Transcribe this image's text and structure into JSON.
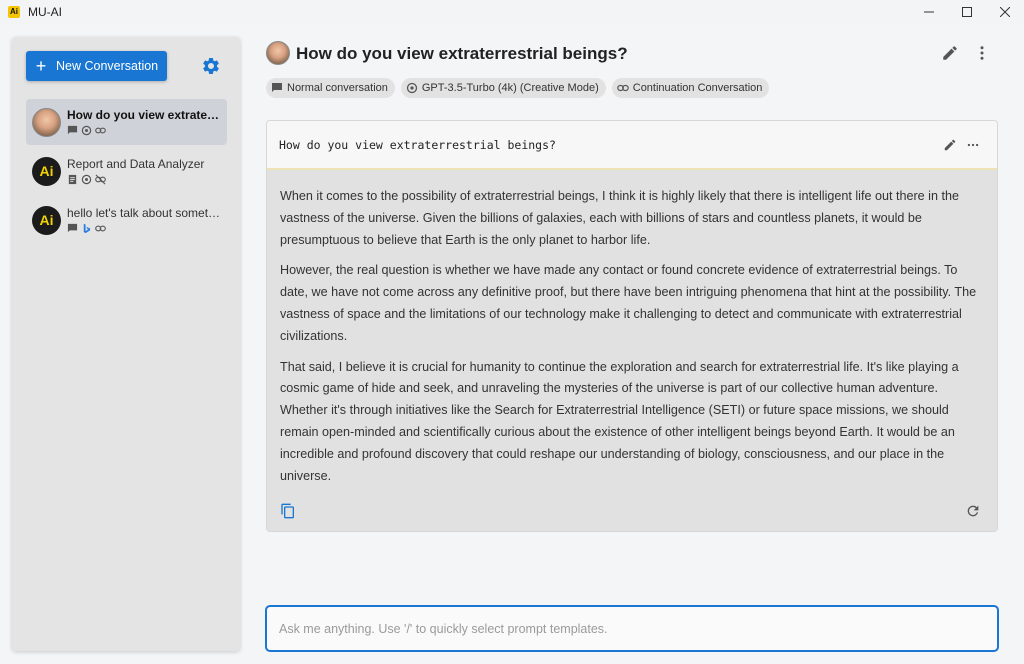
{
  "window": {
    "title": "MU-AI",
    "logo_text": "Ai"
  },
  "sidebar": {
    "new_conversation_label": "New Conversation",
    "conversations": [
      {
        "title": "How do you view extraterrestrial beings?",
        "avatar": "photo",
        "active": true,
        "icons": [
          "chat-icon",
          "openai-icon",
          "link-icon"
        ]
      },
      {
        "title": "Report and Data Analyzer",
        "avatar": "Ai",
        "active": false,
        "icons": [
          "document-icon",
          "openai-icon",
          "link-off-icon"
        ]
      },
      {
        "title": "hello let's talk about something",
        "avatar": "Ai",
        "active": false,
        "icons": [
          "chat-icon",
          "bing-icon",
          "link-icon"
        ]
      }
    ]
  },
  "header": {
    "title": "How do you view extraterrestrial beings?",
    "chips": [
      {
        "label": "Normal conversation",
        "icon": "chat-icon"
      },
      {
        "label": "GPT-3.5-Turbo (4k) (Creative Mode)",
        "icon": "openai-icon"
      },
      {
        "label": "Continuation Conversation",
        "icon": "link-icon"
      }
    ]
  },
  "message": {
    "user_prompt": "How do you view extraterrestrial beings?",
    "response_paragraphs": [
      "When it comes to the possibility of extraterrestrial beings, I think it is highly likely that there is intelligent life out there in the vastness of the universe. Given the billions of galaxies, each with billions of stars and countless planets, it would be presumptuous to believe that Earth is the only planet to harbor life.",
      "However, the real question is whether we have made any contact or found concrete evidence of extraterrestrial beings. To date, we have not come across any definitive proof, but there have been intriguing phenomena that hint at the possibility. The vastness of space and the limitations of our technology make it challenging to detect and communicate with extraterrestrial civilizations.",
      "That said, I believe it is crucial for humanity to continue the exploration and search for extraterrestrial life. It's like playing a cosmic game of hide and seek, and unraveling the mysteries of the universe is part of our collective human adventure. Whether it's through initiatives like the Search for Extraterrestrial Intelligence (SETI) or future space missions, we should remain open-minded and scientifically curious about the existence of other intelligent beings beyond Earth. It would be an incredible and profound discovery that could reshape our understanding of biology, consciousness, and our place in the universe."
    ]
  },
  "input": {
    "placeholder": "Ask me anything. Use '/' to quickly select prompt templates.",
    "value": ""
  },
  "colors": {
    "accent": "#1976d2",
    "sidebar_bg": "#e4e4e4",
    "response_bg": "#e1e1e1",
    "ai_logo_yellow": "#f2d200"
  }
}
